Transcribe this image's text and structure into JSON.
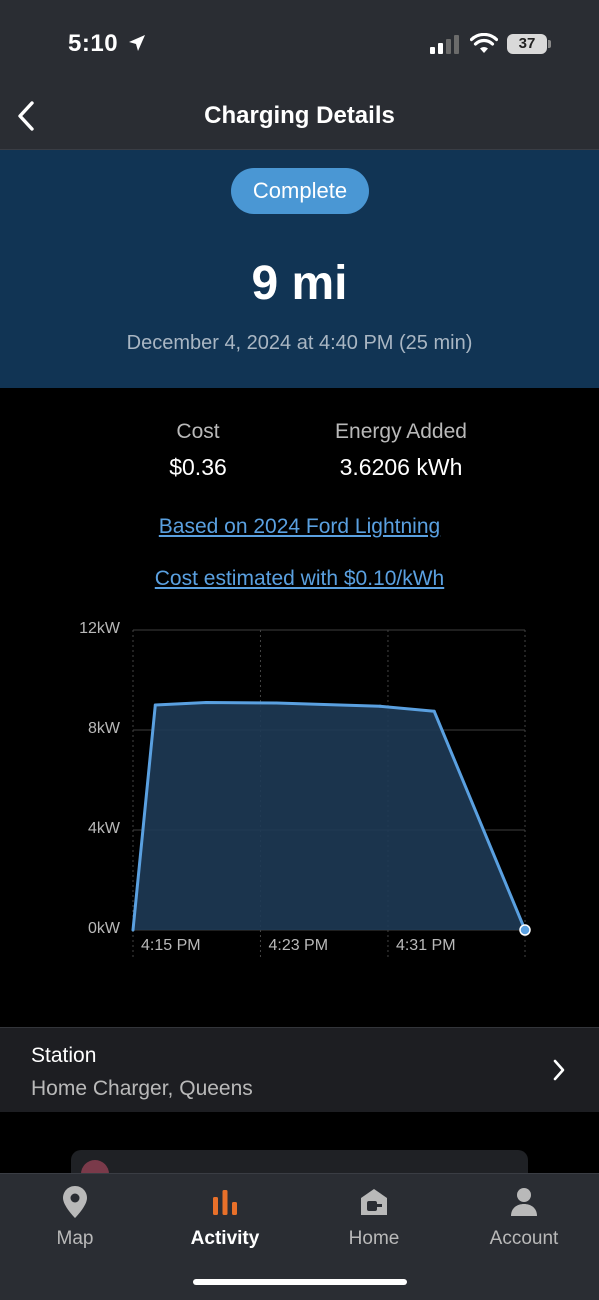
{
  "status_bar": {
    "time": "5:10",
    "battery": "37"
  },
  "nav": {
    "title": "Charging Details"
  },
  "session": {
    "status": "Complete",
    "distance": "9 mi",
    "date": "December 4, 2024 at 4:40 PM (25 min)"
  },
  "stats": {
    "cost_label": "Cost",
    "cost_value": "$0.36",
    "energy_label": "Energy Added",
    "energy_value": "3.6206 kWh"
  },
  "links": {
    "vehicle": "Based on 2024 Ford Lightning",
    "rate": "Cost estimated with $0.10/kWh"
  },
  "chart_data": {
    "type": "area",
    "title": "",
    "xlabel": "",
    "ylabel": "",
    "y_tick_labels": [
      "12kW",
      "8kW",
      "4kW",
      "0kW"
    ],
    "x_tick_labels": [
      "4:15 PM",
      "4:23 PM",
      "4:31 PM"
    ],
    "ylim": [
      0,
      12
    ],
    "x_unit": "minutes after 4:15 PM",
    "x": [
      0,
      1.4,
      4.6,
      9,
      15.5,
      18.9,
      24.6
    ],
    "y": [
      0,
      9.0,
      9.1,
      9.08,
      8.95,
      8.75,
      0
    ],
    "series_color": "#5aa0e0",
    "fill_color": "#1e3a55",
    "grid": true
  },
  "station": {
    "label": "Station",
    "name": "Home Charger, Queens"
  },
  "tabs": [
    {
      "label": "Map",
      "icon": "map-pin-icon"
    },
    {
      "label": "Activity",
      "icon": "activity-bars-icon"
    },
    {
      "label": "Home",
      "icon": "home-charger-icon"
    },
    {
      "label": "Account",
      "icon": "person-icon"
    }
  ],
  "colors": {
    "accent": "#e8702a",
    "hero_bg": "#113454",
    "pill": "#4a97d4",
    "link": "#5aa0e0"
  }
}
